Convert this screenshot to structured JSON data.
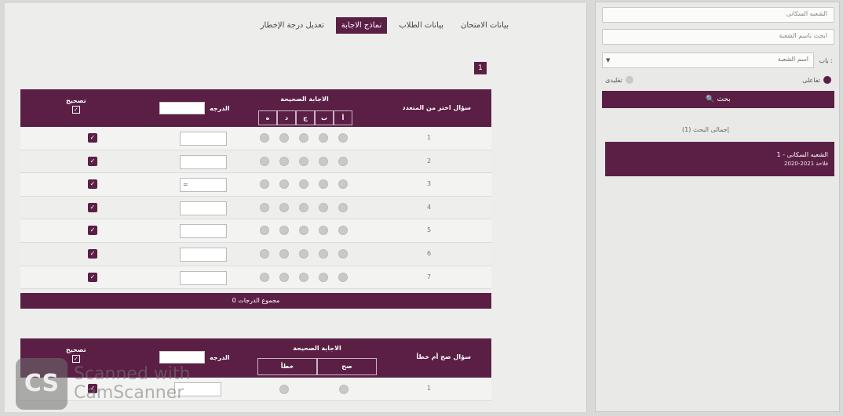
{
  "tabs": [
    "بيانات الامتحان",
    "بيانات الطلاب",
    "نماذج الاجابة",
    "تعديل درجة الإخطار"
  ],
  "active_tab": "نماذج الاجابة",
  "page_number": "1",
  "mcq": {
    "title": "سؤال اختر من المتعدد",
    "correct_answer_label": "الاجابة الصحيحة",
    "options": [
      "أ",
      "ب",
      "ج",
      "د",
      "ه"
    ],
    "grade_label": "الدرجه",
    "fix_label": "تصحيح",
    "rows": [
      {
        "num": "1",
        "grade": ""
      },
      {
        "num": "2",
        "grade": ""
      },
      {
        "num": "3",
        "grade": "="
      },
      {
        "num": "4",
        "grade": ""
      },
      {
        "num": "5",
        "grade": ""
      },
      {
        "num": "6",
        "grade": ""
      },
      {
        "num": "7",
        "grade": ""
      }
    ],
    "total_label": "مجموع الدرجات 0"
  },
  "tf": {
    "title": "سؤال صح أم خطأ",
    "correct_answer_label": "الاجابة الصحيحة",
    "options": [
      "صح",
      "خطأ"
    ],
    "grade_label": "الدرجه",
    "fix_label": "تصحيح",
    "rows": [
      {
        "num": "1"
      }
    ]
  },
  "watermark": {
    "logo": "CS",
    "line1": "Scanned with",
    "line2": "CamScanner"
  },
  "sidebar": {
    "field1_placeholder": "الشعبه السكانى",
    "field2_placeholder": "ابحث باسم الشعبة",
    "branch_label": "باب :",
    "branch_value": "اسم الشعبة",
    "radio1": "تفاعلى",
    "radio2": "تقليدى",
    "search_label": "🔍 بحث",
    "total_label": "إجمالى البحث (1)",
    "result_title": "1 - الشعبه السكانى",
    "result_sub": "2020-2021 فلاحة"
  },
  "colors": {
    "accent": "#5b1f45"
  }
}
